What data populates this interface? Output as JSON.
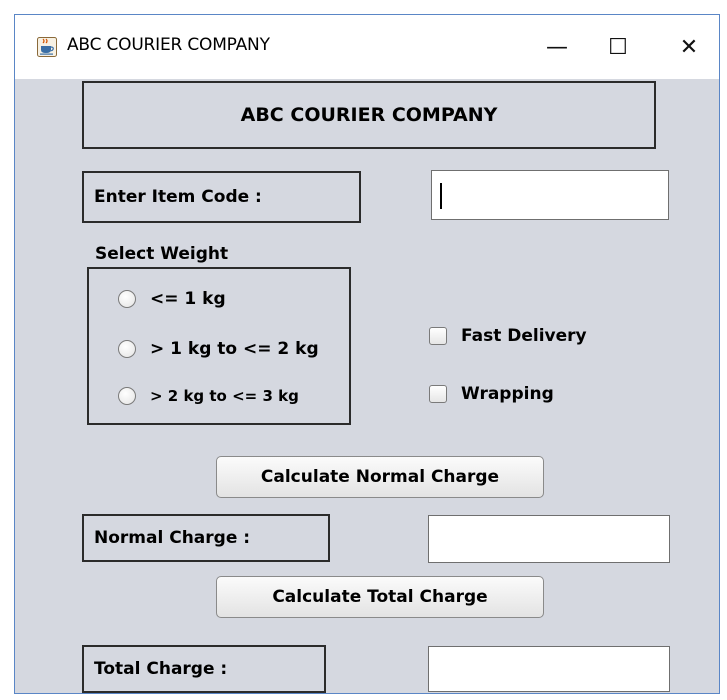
{
  "window": {
    "title": "ABC COURIER COMPANY",
    "controls": {
      "minimize": "—",
      "maximize": "☐",
      "close": "✕"
    }
  },
  "header": {
    "title": "ABC COURIER COMPANY"
  },
  "item_code": {
    "label": "Enter Item Code :",
    "value": ""
  },
  "weight": {
    "group_label": "Select Weight",
    "options": [
      {
        "label": "<= 1 kg",
        "selected": false
      },
      {
        "label": "> 1 kg to <= 2 kg",
        "selected": false
      },
      {
        "label": "> 2 kg to <= 3 kg",
        "selected": false
      }
    ]
  },
  "extras": {
    "fast_delivery": {
      "label": "Fast Delivery",
      "checked": false
    },
    "wrapping": {
      "label": "Wrapping",
      "checked": false
    }
  },
  "buttons": {
    "calc_normal": "Calculate Normal Charge",
    "calc_total": "Calculate Total Charge"
  },
  "normal_charge": {
    "label": "Normal Charge :",
    "value": ""
  },
  "total_charge": {
    "label": "Total Charge :",
    "value": ""
  },
  "colors": {
    "window_bg": "#d5d8e0",
    "window_border": "#5a86c6",
    "titlebar_bg": "#ffffff"
  },
  "icons": {
    "app": "java-cup-icon",
    "minimize": "minimize-icon",
    "maximize": "maximize-icon",
    "close": "close-icon"
  }
}
